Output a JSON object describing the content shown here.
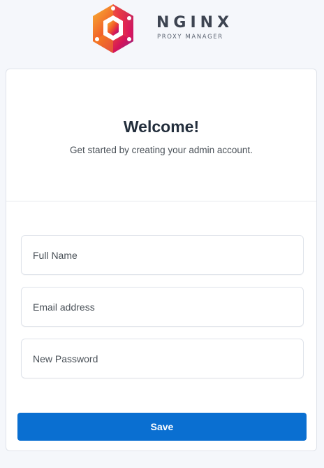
{
  "brand": {
    "name": "NGINX",
    "subtitle": "PROXY MANAGER",
    "logo_icon": "nginx-proxy-manager-hexagon-logo"
  },
  "card": {
    "title": "Welcome!",
    "subtitle": "Get started by creating your admin account."
  },
  "form": {
    "full_name": {
      "placeholder": "Full Name",
      "value": ""
    },
    "email": {
      "placeholder": "Email address",
      "value": ""
    },
    "password": {
      "placeholder": "New Password",
      "value": ""
    },
    "save_label": "Save"
  },
  "colors": {
    "accent": "#0a6fd1",
    "page_background": "#f5f7fb",
    "card_background": "#ffffff",
    "border": "#dfe3ea",
    "text_primary": "#232e3c"
  }
}
